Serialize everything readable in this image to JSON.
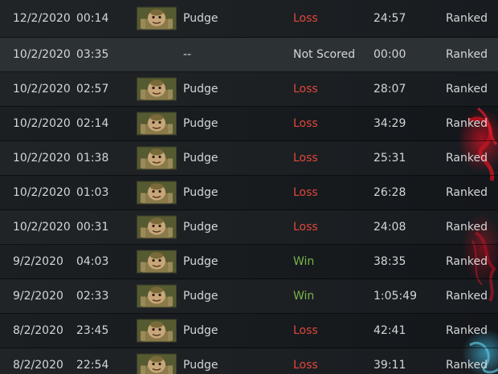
{
  "matches": [
    {
      "date": "12/2/2020",
      "time": "00:14",
      "hero": "Pudge",
      "hero_icon": "pudge-portrait",
      "result": "Loss",
      "result_type": "loss",
      "duration": "24:57",
      "mode": "Ranked"
    },
    {
      "date": "10/2/2020",
      "time": "03:35",
      "hero": "--",
      "hero_icon": "",
      "result": "Not Scored",
      "result_type": "notscored",
      "duration": "00:00",
      "mode": "Ranked"
    },
    {
      "date": "10/2/2020",
      "time": "02:57",
      "hero": "Pudge",
      "hero_icon": "pudge-portrait",
      "result": "Loss",
      "result_type": "loss",
      "duration": "28:07",
      "mode": "Ranked"
    },
    {
      "date": "10/2/2020",
      "time": "02:14",
      "hero": "Pudge",
      "hero_icon": "pudge-portrait",
      "result": "Loss",
      "result_type": "loss",
      "duration": "34:29",
      "mode": "Ranked"
    },
    {
      "date": "10/2/2020",
      "time": "01:38",
      "hero": "Pudge",
      "hero_icon": "pudge-portrait",
      "result": "Loss",
      "result_type": "loss",
      "duration": "25:31",
      "mode": "Ranked"
    },
    {
      "date": "10/2/2020",
      "time": "01:03",
      "hero": "Pudge",
      "hero_icon": "pudge-portrait",
      "result": "Loss",
      "result_type": "loss",
      "duration": "26:28",
      "mode": "Ranked"
    },
    {
      "date": "10/2/2020",
      "time": "00:31",
      "hero": "Pudge",
      "hero_icon": "pudge-portrait",
      "result": "Loss",
      "result_type": "loss",
      "duration": "24:08",
      "mode": "Ranked"
    },
    {
      "date": "9/2/2020",
      "time": "04:03",
      "hero": "Pudge",
      "hero_icon": "pudge-portrait",
      "result": "Win",
      "result_type": "win",
      "duration": "38:35",
      "mode": "Ranked"
    },
    {
      "date": "9/2/2020",
      "time": "02:33",
      "hero": "Pudge",
      "hero_icon": "pudge-portrait",
      "result": "Win",
      "result_type": "win",
      "duration": "1:05:49",
      "mode": "Ranked"
    },
    {
      "date": "8/2/2020",
      "time": "23:45",
      "hero": "Pudge",
      "hero_icon": "pudge-portrait",
      "result": "Loss",
      "result_type": "loss",
      "duration": "42:41",
      "mode": "Ranked"
    },
    {
      "date": "8/2/2020",
      "time": "22:54",
      "hero": "Pudge",
      "hero_icon": "pudge-portrait",
      "result": "Loss",
      "result_type": "loss",
      "duration": "39:11",
      "mode": "Ranked"
    }
  ],
  "colors": {
    "loss": "#e0463c",
    "win": "#7ab34a",
    "text": "#d4d6d8",
    "row_highlight": "#2c3133"
  }
}
